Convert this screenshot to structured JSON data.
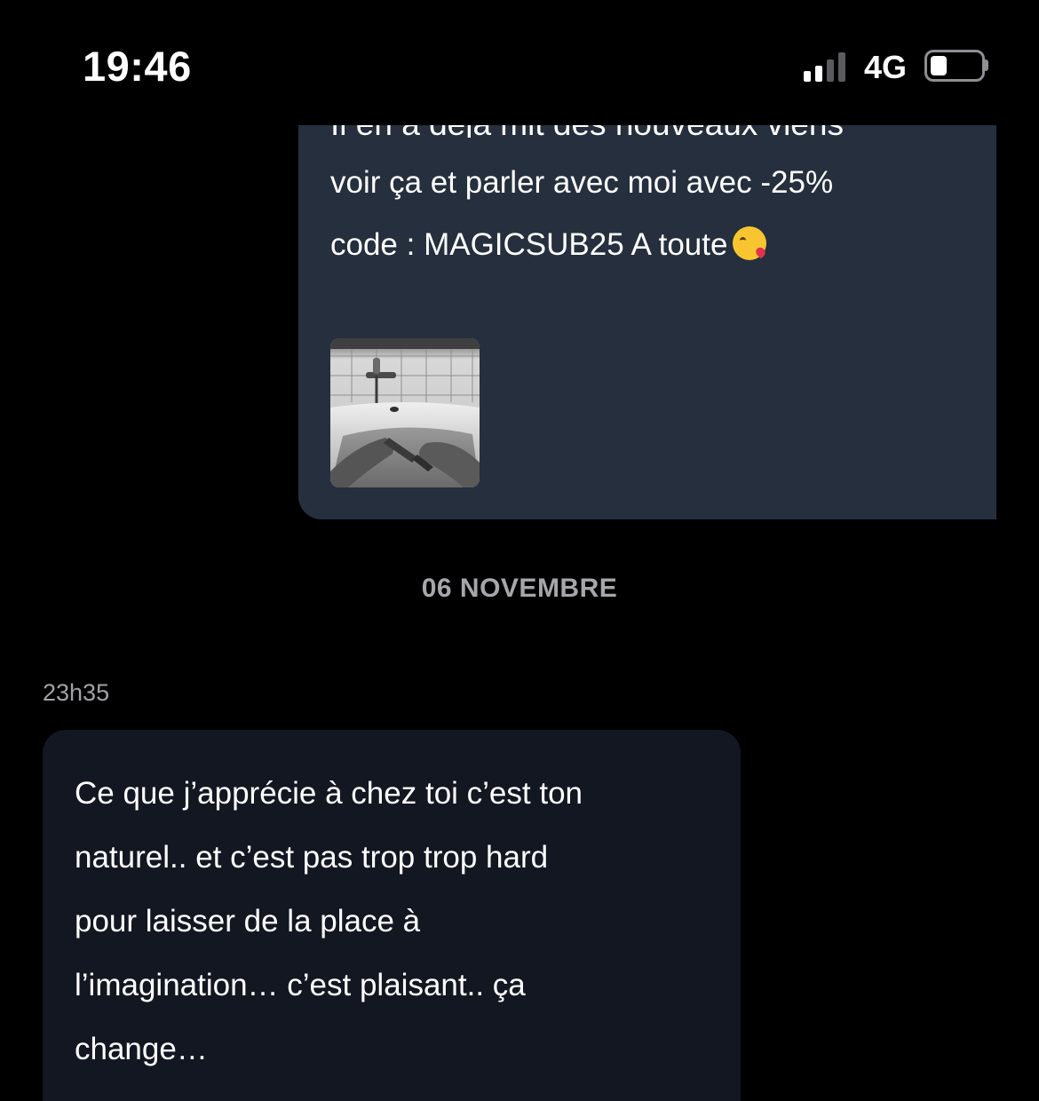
{
  "status_bar": {
    "time": "19:46",
    "network": "4G"
  },
  "thread": {
    "outgoing": {
      "partial_line": "Il en a déjà mit des nouveaux viens",
      "lines": [
        "voir ça et parler avec moi avec -25%",
        "code : MAGICSUB25 A toute"
      ],
      "emoji": "kissing-face-with-heart",
      "attachment": "bathtub-photo"
    },
    "date_separator": "06 NOVEMBRE",
    "incoming": {
      "time": "23h35",
      "lines": [
        "Ce que j’apprécie à chez toi c’est ton",
        "naturel.. et c’est pas trop trop hard",
        "pour laisser de la place à",
        "l’imagination… c’est plaisant.. ça",
        "change…"
      ]
    }
  },
  "colors": {
    "background": "#000000",
    "outgoing_bubble": "#252f3e",
    "incoming_bubble": "#131722",
    "muted_text": "#a6a6ab"
  }
}
